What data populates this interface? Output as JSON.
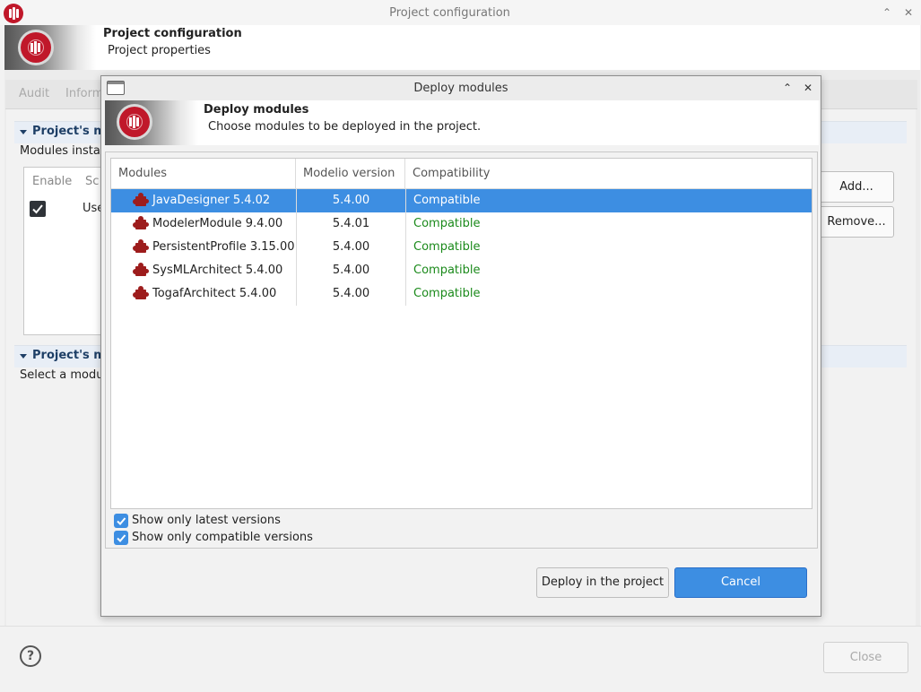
{
  "window": {
    "title": "Project configuration",
    "header_title": "Project configuration",
    "header_subtitle": "Project properties",
    "tabs": [
      "Audit",
      "Inform"
    ],
    "sections": [
      {
        "title": "Project's mo",
        "text": "Modules install"
      },
      {
        "title": "Project's mo",
        "text": "Select a modul"
      }
    ],
    "table_headers": {
      "enable": "Enable",
      "scope": "Sc"
    },
    "table_row": {
      "scope": "Use"
    },
    "buttons": {
      "add": "Add...",
      "remove": "Remove...",
      "close": "Close"
    },
    "help": "?"
  },
  "dialog": {
    "title": "Deploy modules",
    "header_title": "Deploy modules",
    "header_subtitle": "Choose modules to be deployed in the project.",
    "columns": {
      "modules": "Modules",
      "version": "Modelio version",
      "compatibility": "Compatibility"
    },
    "rows": [
      {
        "name": "JavaDesigner 5.4.02",
        "version": "5.4.00",
        "compatibility": "Compatible",
        "selected": true
      },
      {
        "name": "ModelerModule 9.4.00",
        "version": "5.4.01",
        "compatibility": "Compatible",
        "selected": false
      },
      {
        "name": "PersistentProfile 3.15.00",
        "version": "5.4.00",
        "compatibility": "Compatible",
        "selected": false
      },
      {
        "name": "SysMLArchitect 5.4.00",
        "version": "5.4.00",
        "compatibility": "Compatible",
        "selected": false
      },
      {
        "name": "TogafArchitect 5.4.00",
        "version": "5.4.00",
        "compatibility": "Compatible",
        "selected": false
      }
    ],
    "options": {
      "latest": {
        "label": "Show only latest versions",
        "checked": true
      },
      "compatible": {
        "label": "Show only compatible versions",
        "checked": true
      }
    },
    "buttons": {
      "deploy": "Deploy in the project",
      "cancel": "Cancel"
    }
  },
  "colors": {
    "accent": "#3d8ee2",
    "brand": "#c0182a",
    "compatible": "#1b8a1b",
    "section_title": "#1e3f66"
  }
}
